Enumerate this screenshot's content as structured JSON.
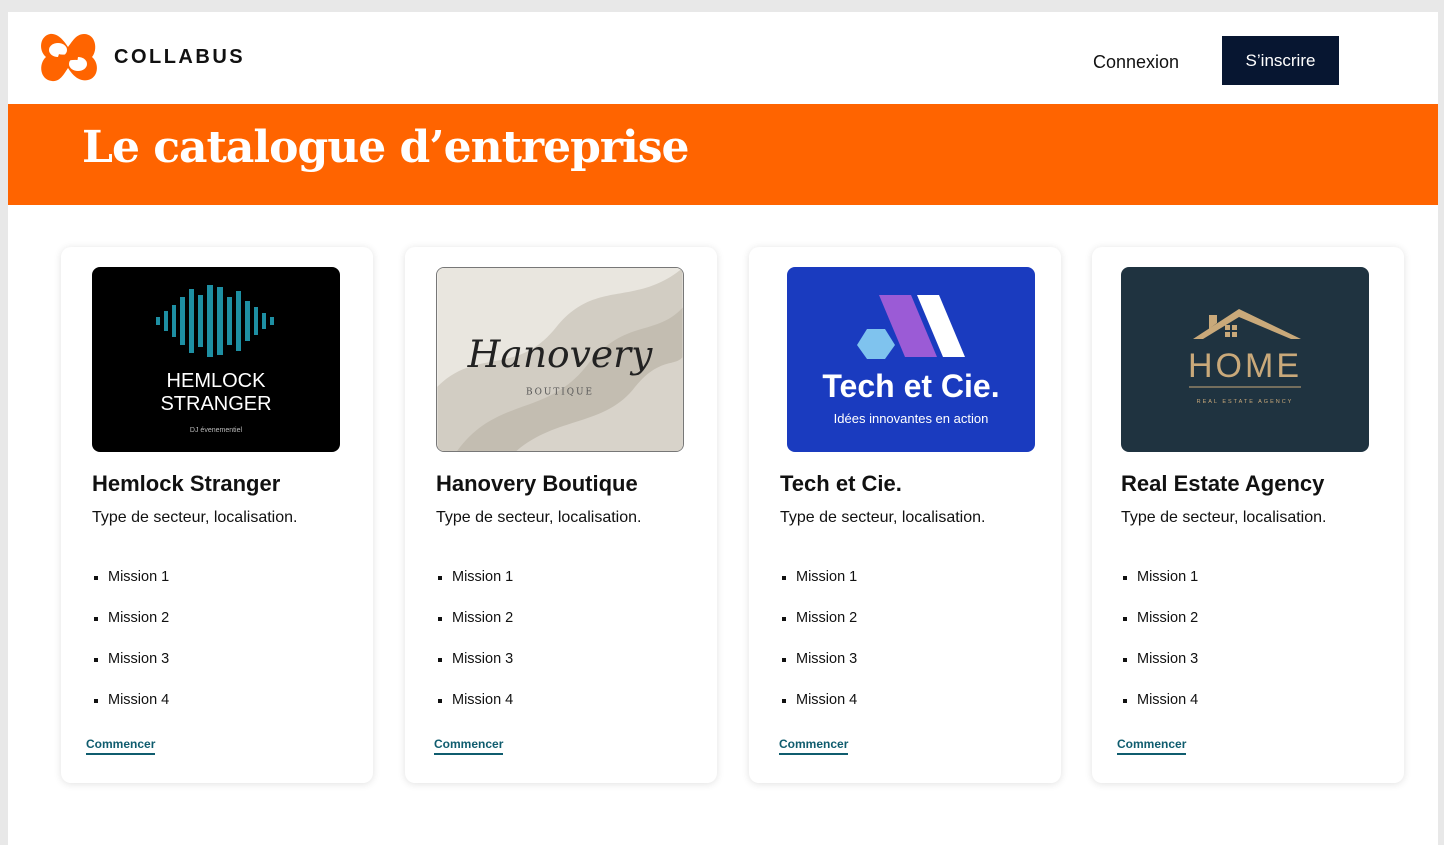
{
  "header": {
    "brand": "COLLABUS",
    "login_label": "Connexion",
    "signup_label": "S’inscrire"
  },
  "banner": {
    "title": "Le catalogue d’entreprise"
  },
  "colors": {
    "accent": "#ff6400",
    "dark": "#071631",
    "link": "#0f5c6e"
  },
  "cards": [
    {
      "name": "Hemlock Stranger",
      "subtitle": "Type de secteur, localisation.",
      "missions": [
        "Mission 1",
        "Mission 2",
        "Mission 3",
        "Mission 4"
      ],
      "cta": "Commencer",
      "logo": {
        "line1": "HEMLOCK",
        "line2": "STRANGER",
        "tagline": "DJ évenementiel"
      }
    },
    {
      "name": "Hanovery Boutique",
      "subtitle": "Type de secteur, localisation.",
      "missions": [
        "Mission 1",
        "Mission 2",
        "Mission 3",
        "Mission 4"
      ],
      "cta": "Commencer",
      "logo": {
        "script": "Hanovery",
        "sub": "BOUTIQUE"
      }
    },
    {
      "name": "Tech et Cie.",
      "subtitle": "Type de secteur, localisation.",
      "missions": [
        "Mission 1",
        "Mission 2",
        "Mission 3",
        "Mission 4"
      ],
      "cta": "Commencer",
      "logo": {
        "title": "Tech et Cie.",
        "tagline": "Idées innovantes en action"
      }
    },
    {
      "name": "Real Estate Agency",
      "subtitle": "Type de secteur, localisation.",
      "missions": [
        "Mission 1",
        "Mission 2",
        "Mission 3",
        "Mission 4"
      ],
      "cta": "Commencer",
      "logo": {
        "title": "HOME",
        "tagline": "REAL ESTATE AGENCY"
      }
    }
  ]
}
